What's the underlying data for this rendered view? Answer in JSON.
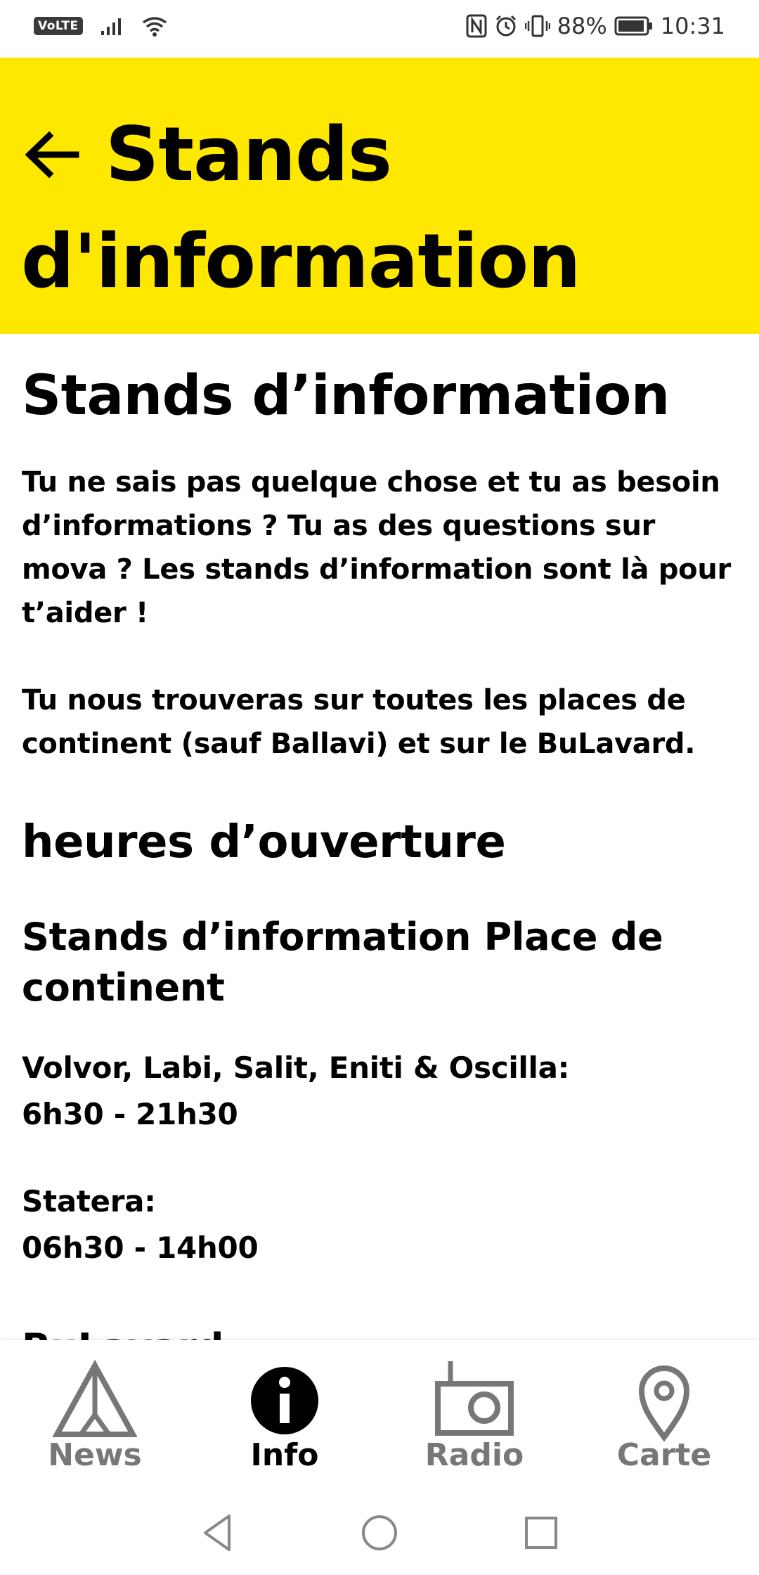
{
  "status_bar": {
    "volte": "VoLTE",
    "battery": "88%",
    "time": "10:31"
  },
  "header": {
    "title": "Stands d'information",
    "background_color": "#FFE800"
  },
  "content": {
    "title": "Stands d’information",
    "paragraph1": "Tu ne sais pas quelque chose et tu as besoin d’informations ? Tu as des questions sur mova ? Les stands d’information sont là pour t’aider !",
    "paragraph2": "Tu nous trouveras sur toutes les places de continent (sauf Ballavi) et sur le BuLavard.",
    "hours_heading": "heures d’ouverture",
    "subheading": "Stands d’information Place de continent",
    "line1": "Volvor, Labi, Salit, Eniti & Oscilla:",
    "line2": "6h30 - 21h30",
    "line3": "Statera:",
    "line4": "06h30 - 14h00",
    "cut_heading": "BuLavard"
  },
  "bottom_nav": {
    "items": [
      {
        "label": "News",
        "icon": "tent-icon"
      },
      {
        "label": "Info",
        "icon": "info-icon"
      },
      {
        "label": "Radio",
        "icon": "radio-icon"
      },
      {
        "label": "Carte",
        "icon": "map-pin-icon"
      }
    ],
    "active": "Info"
  }
}
